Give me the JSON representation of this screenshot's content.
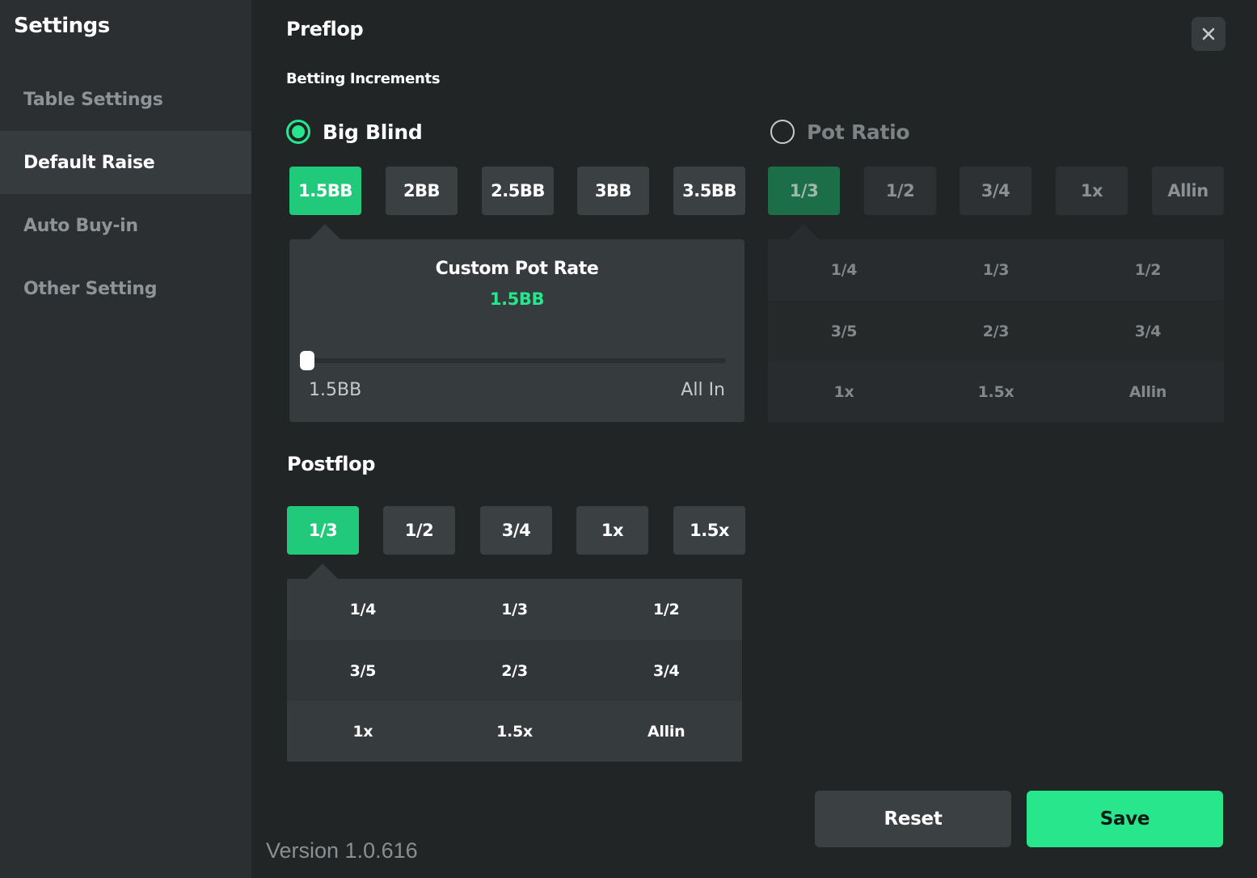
{
  "sidebar": {
    "title": "Settings",
    "items": [
      {
        "label": "Table Settings",
        "active": false
      },
      {
        "label": "Default Raise",
        "active": true
      },
      {
        "label": "Auto Buy-in",
        "active": false
      },
      {
        "label": "Other Setting",
        "active": false
      }
    ]
  },
  "preflop": {
    "title": "Preflop",
    "subtitle": "Betting Increments",
    "modes": [
      {
        "label": "Big Blind",
        "selected": true
      },
      {
        "label": "Pot Ratio",
        "selected": false
      }
    ],
    "big_blind_options": [
      "1.5BB",
      "2BB",
      "2.5BB",
      "3BB",
      "3.5BB"
    ],
    "big_blind_selected": "1.5BB",
    "pot_ratio_options": [
      "1/3",
      "1/2",
      "3/4",
      "1x",
      "Allin"
    ],
    "pot_ratio_selected": "1/3",
    "custom": {
      "title": "Custom Pot Rate",
      "value": "1.5BB",
      "slider_min_label": "1.5BB",
      "slider_max_label": "All In",
      "slider_position": 0
    },
    "pot_ratio_grid": [
      [
        "1/4",
        "1/3",
        "1/2"
      ],
      [
        "3/5",
        "2/3",
        "3/4"
      ],
      [
        "1x",
        "1.5x",
        "Allin"
      ]
    ]
  },
  "postflop": {
    "title": "Postflop",
    "options": [
      "1/3",
      "1/2",
      "3/4",
      "1x",
      "1.5x"
    ],
    "selected": "1/3",
    "grid": [
      [
        "1/4",
        "1/3",
        "1/2"
      ],
      [
        "3/5",
        "2/3",
        "3/4"
      ],
      [
        "1x",
        "1.5x",
        "Allin"
      ]
    ]
  },
  "actions": {
    "reset_label": "Reset",
    "save_label": "Save"
  },
  "version": "Version 1.0.616",
  "colors": {
    "accent": "#27e68c",
    "selected_chip": "#21c97a",
    "save_button": "#27e68c"
  }
}
